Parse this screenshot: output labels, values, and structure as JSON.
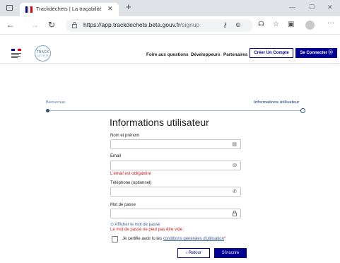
{
  "browser": {
    "tab_title": "Trackdéchets | La traçabilité des",
    "tab_close": "✕",
    "new_tab": "+",
    "url_host": "https://app.trackdechets.beta.gouv.fr",
    "url_path": "/signup",
    "minimize": "—",
    "maximize": "☐",
    "close": "✕",
    "menu": "···"
  },
  "header": {
    "logo_line1": "TRACK",
    "logo_line2": "DÉCHETS",
    "nav": {
      "faq": "Foire aux questions",
      "developers": "Développeurs",
      "partners": "Partenaires"
    },
    "create_account": "Créer Un Compte",
    "login": "Se Connecter ⓞ"
  },
  "stepper": {
    "step1": "Bienvenue",
    "step2": "Informations utilisateur"
  },
  "form": {
    "title": "Informations utilisateur",
    "name_label": "Nom et prénom",
    "email_label": "Email",
    "email_error": "L'email est obligatoire",
    "phone_label": "Téléphone (optionnel)",
    "password_label": "Mot de passe",
    "show_password": "⊙ Afficher le mot de passe",
    "password_error": "Le mot de passe ne peut pas être vide",
    "cgu_prefix": "Je certifie avoir lu les ",
    "cgu_link": "conditions générales d'utilisation",
    "cgu_star": "*",
    "back": "‹ Retour",
    "submit": "S'inscrire"
  },
  "colors": {
    "brand_blue": "#000091",
    "error_red": "#c9191e",
    "link_blue": "#3a62a0"
  }
}
